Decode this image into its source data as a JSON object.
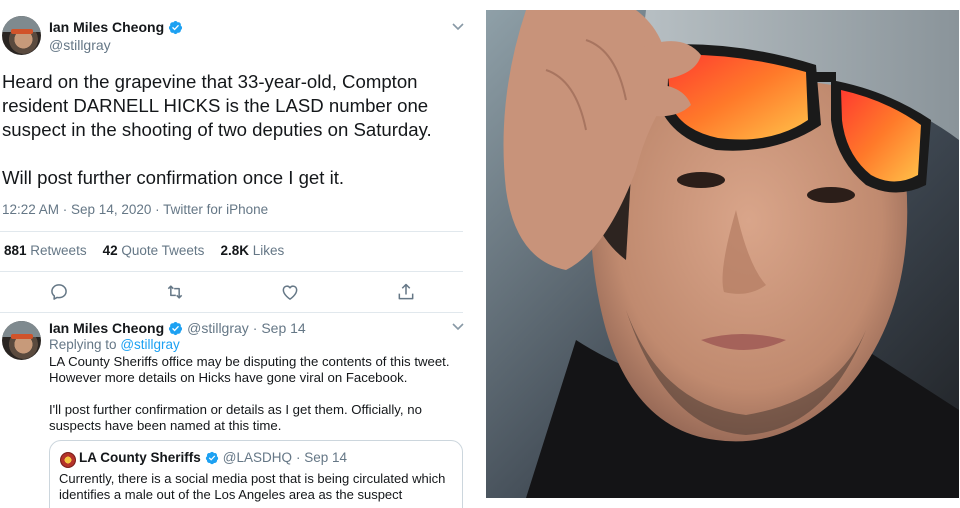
{
  "main_tweet": {
    "author_name": "Ian Miles Cheong",
    "handle": "@stillgray",
    "text": "Heard on the grapevine that 33-year-old, Compton resident DARNELL HICKS is the LASD number one suspect in the shooting of two deputies on Saturday.\n\nWill post further confirmation once I get it.",
    "timestamp": "12:22 AM · Sep 14, 2020 · Twitter for iPhone",
    "stats": {
      "retweets_count": "881",
      "retweets_label": "Retweets",
      "quotes_count": "42",
      "quotes_label": "Quote Tweets",
      "likes_count": "2.8K",
      "likes_label": "Likes"
    }
  },
  "reply_tweet": {
    "author_name": "Ian Miles Cheong",
    "handle": "@stillgray",
    "date": "· Sep 14",
    "replying_prefix": "Replying to",
    "replying_handle": "@stillgray",
    "text": "LA County Sheriffs office may be disputing the contents of this tweet. However more details on Hicks have gone viral on Facebook.\n\nI'll post further confirmation or details as I get them. Officially, no suspects have been named at this time."
  },
  "quoted_tweet": {
    "author_name": "LA County Sheriffs",
    "handle": "@LASDHQ",
    "date": "· Sep 14",
    "text": "Currently, there is a social media post that is being circulated which identifies a male out of the Los Angeles area as the suspect"
  },
  "colors": {
    "twitter_blue": "#1da1f2",
    "secondary_text": "#657786",
    "divider": "#e1e8ed"
  },
  "icons": [
    "verified-badge-icon",
    "chevron-down-icon",
    "reply-icon",
    "retweet-icon",
    "like-icon",
    "share-icon"
  ]
}
